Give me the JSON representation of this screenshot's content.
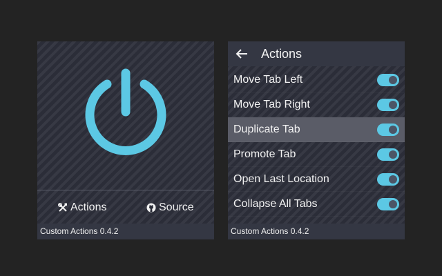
{
  "theme": {
    "accent": "#5cc8e4",
    "panel_bg": "#2b2d38",
    "header_bg": "#343743",
    "highlight_bg": "#5a5c67",
    "page_bg": "#232323"
  },
  "main_popup": {
    "power_icon": "power-icon",
    "links": [
      {
        "icon": "tools-icon",
        "label": "Actions"
      },
      {
        "icon": "github-icon",
        "label": "Source"
      }
    ],
    "footer": "Custom Actions 0.4.2"
  },
  "actions_popup": {
    "back_icon": "arrow-left-icon",
    "title": "Actions",
    "items": [
      {
        "label": "Move Tab Left",
        "enabled": true,
        "highlighted": false
      },
      {
        "label": "Move Tab Right",
        "enabled": true,
        "highlighted": false
      },
      {
        "label": "Duplicate Tab",
        "enabled": true,
        "highlighted": true
      },
      {
        "label": "Promote Tab",
        "enabled": true,
        "highlighted": false
      },
      {
        "label": "Open Last Location",
        "enabled": true,
        "highlighted": false
      },
      {
        "label": "Collapse All Tabs",
        "enabled": true,
        "highlighted": false
      }
    ],
    "footer": "Custom Actions 0.4.2"
  }
}
